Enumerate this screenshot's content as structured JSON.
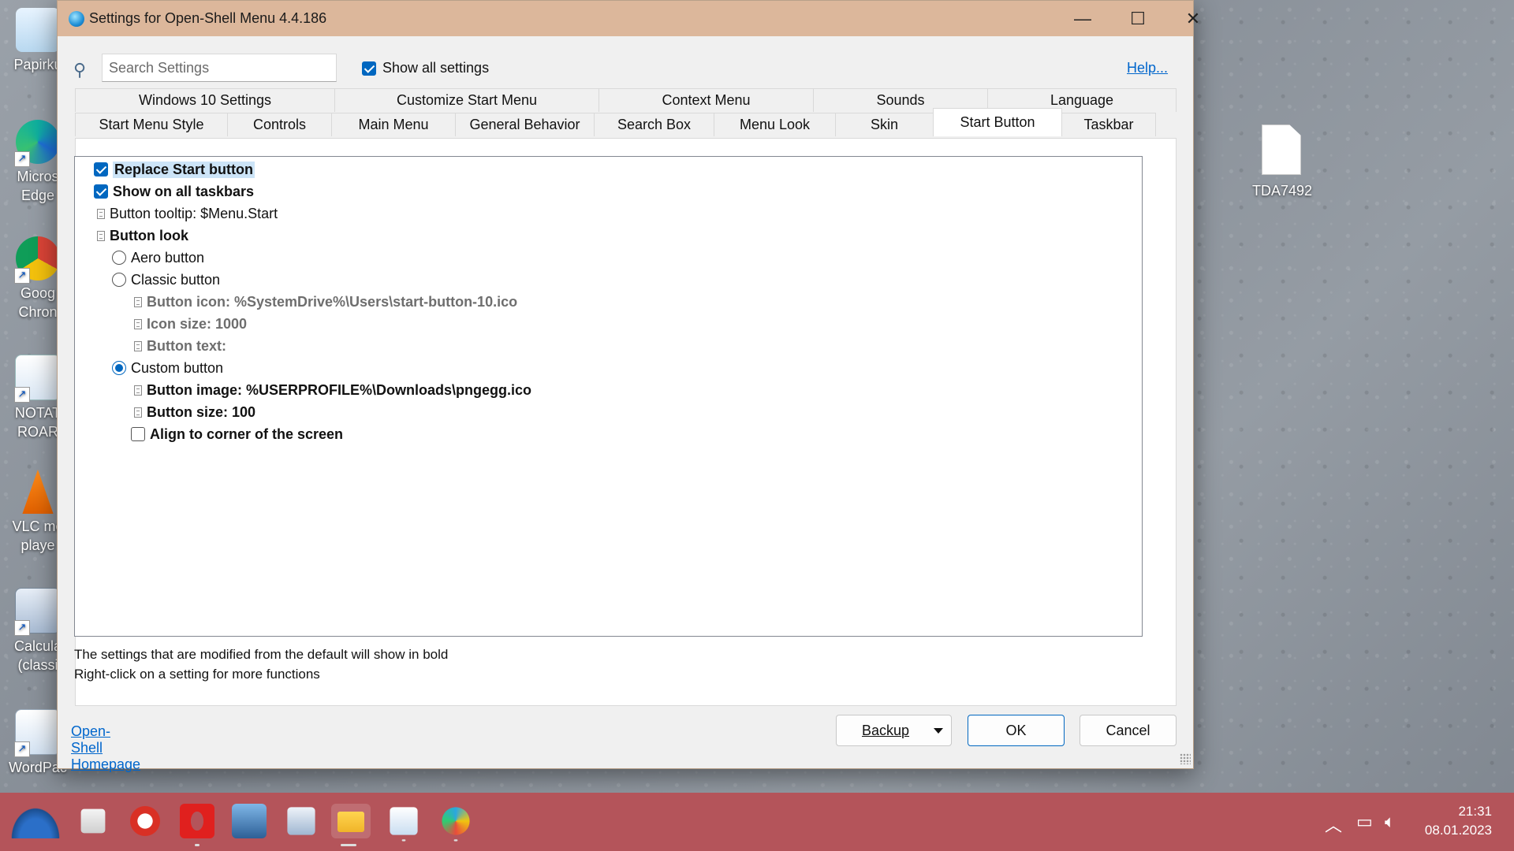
{
  "window": {
    "title": "Settings for Open-Shell Menu 4.4.186",
    "minimize_icon": "—",
    "maximize_icon": "☐",
    "close_icon": "✕"
  },
  "search": {
    "placeholder": "Search Settings",
    "value": ""
  },
  "show_all_settings": {
    "label": "Show all settings",
    "checked": true
  },
  "help_link": "Help...",
  "tabs": {
    "row1": [
      "Windows 10 Settings",
      "Customize Start Menu",
      "Context Menu",
      "Sounds",
      "Language"
    ],
    "row2": [
      "Start Menu Style",
      "Controls",
      "Main Menu",
      "General Behavior",
      "Search Box",
      "Menu Look",
      "Skin",
      "Start Button",
      "Taskbar"
    ],
    "active": "Start Button"
  },
  "settings": [
    {
      "label": "Replace Start button",
      "type": "checkbox",
      "checked": true,
      "bold": true,
      "selected": true
    },
    {
      "label": "Show on all taskbars",
      "type": "checkbox",
      "checked": true,
      "bold": true
    },
    {
      "label": "Button tooltip: $Menu.Start",
      "type": "doc",
      "bold": false
    },
    {
      "label": "Button look",
      "type": "doc",
      "bold": true
    },
    {
      "label": "Aero button",
      "type": "radio",
      "checked": false
    },
    {
      "label": "Classic button",
      "type": "radio",
      "checked": false
    },
    {
      "label": "Button icon: %SystemDrive%\\Users\\start-button-10.ico",
      "type": "doc",
      "disabled": true
    },
    {
      "label": "Icon size: 1000",
      "type": "doc",
      "disabled": true
    },
    {
      "label": "Button text:",
      "type": "doc",
      "disabled": true
    },
    {
      "label": "Custom button",
      "type": "radio",
      "checked": true
    },
    {
      "label": "Button image: %USERPROFILE%\\Downloads\\pngegg.ico",
      "type": "doc",
      "bold": true
    },
    {
      "label": "Button size: 100",
      "type": "doc",
      "bold": true
    },
    {
      "label": "Align to corner of the screen",
      "type": "checkbox",
      "checked": false,
      "bold": true
    }
  ],
  "info": {
    "line1": "The settings that are modified from the default will show in bold",
    "line2": "Right-click on a setting for more functions"
  },
  "homepage_link": "Open-Shell Homepage",
  "buttons": {
    "backup": "Backup",
    "ok": "OK",
    "cancel": "Cancel"
  },
  "desktop": {
    "icons": [
      {
        "label": "Papirku",
        "icon": "recycle-bin-icon"
      },
      {
        "label": "Micros Edge",
        "icon": "edge-icon"
      },
      {
        "label": "Goog Chron",
        "icon": "chrome-icon"
      },
      {
        "label": "NOTAT ROAR",
        "icon": "wordpad-doc-icon"
      },
      {
        "label": "VLC me playe",
        "icon": "vlc-icon"
      },
      {
        "label": "Calcula (classi",
        "icon": "calculator-icon"
      },
      {
        "label": "WordPac",
        "icon": "wordpad-icon"
      }
    ],
    "file": {
      "label": "TDA7492",
      "icon": "blank-file-icon"
    }
  },
  "taskbar": {
    "clock_time": "21:31",
    "clock_date": "08.01.2023",
    "colors": {
      "taskbar": "#b4545a",
      "accent": "#0067c0"
    }
  }
}
